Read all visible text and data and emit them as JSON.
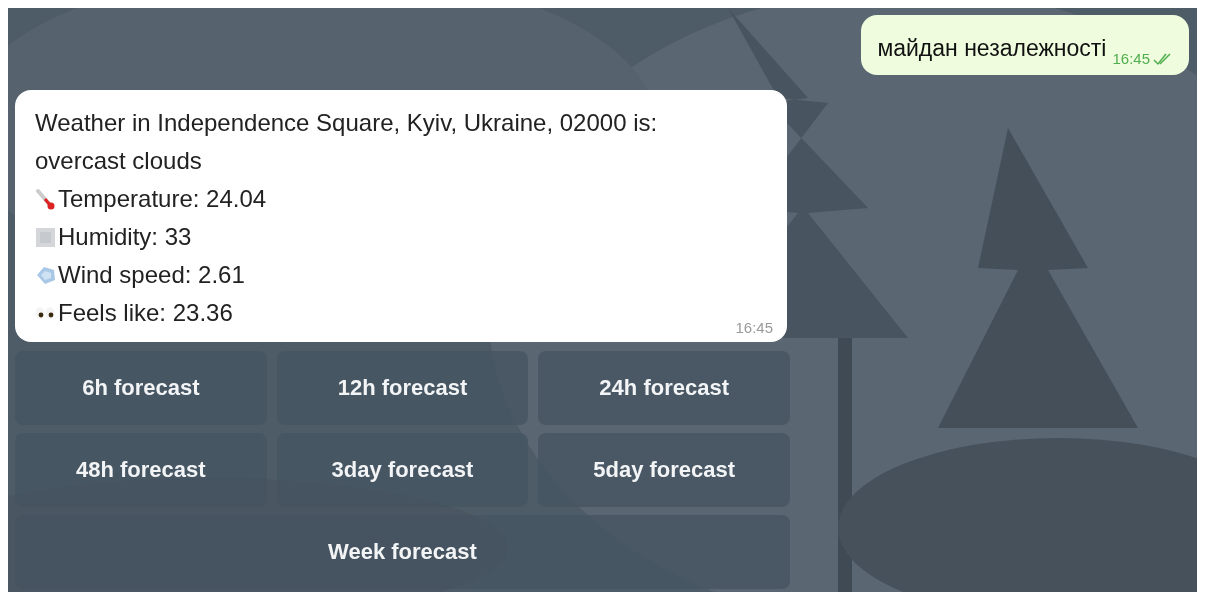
{
  "outgoing_message": {
    "text": "майдан незалежності",
    "time": "16:45",
    "read": true
  },
  "incoming_message": {
    "lines": [
      {
        "kind": "text",
        "text": "Weather in Independence Square, Kyiv, Ukraine, 02000 is:"
      },
      {
        "kind": "text",
        "text": "overcast clouds"
      },
      {
        "kind": "thermometer",
        "text": "Temperature: 24.04"
      },
      {
        "kind": "humidity",
        "text": "Humidity: 33"
      },
      {
        "kind": "wind",
        "text": "Wind speed: 2.61"
      },
      {
        "kind": "eyes",
        "text": "Feels like: 23.36"
      }
    ],
    "time": "16:45"
  },
  "keyboard": {
    "rows": [
      {
        "buttons": [
          "6h forecast",
          "12h forecast",
          "24h forecast"
        ]
      },
      {
        "buttons": [
          "48h forecast",
          "3day forecast",
          "5day forecast"
        ]
      },
      {
        "buttons": [
          "Week forecast"
        ]
      }
    ]
  }
}
